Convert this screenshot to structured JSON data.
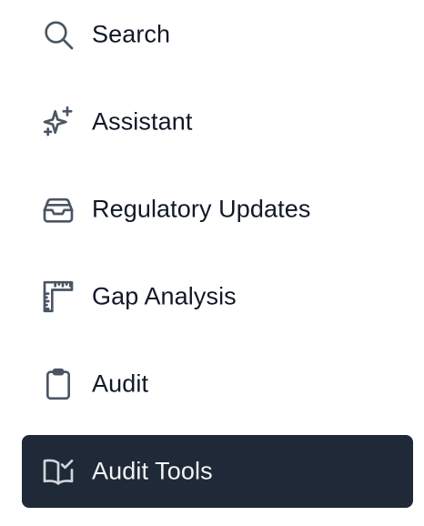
{
  "colors": {
    "background": "#ffffff",
    "text": "#111827",
    "icon": "#4b5563",
    "active_background": "#1f2937",
    "active_text": "#f3f4f6"
  },
  "nav": {
    "items": [
      {
        "label": "Search",
        "icon": "search-icon",
        "active": false
      },
      {
        "label": "Assistant",
        "icon": "sparkles-icon",
        "active": false
      },
      {
        "label": "Regulatory Updates",
        "icon": "inbox-stack-icon",
        "active": false
      },
      {
        "label": "Gap Analysis",
        "icon": "ruler-square-icon",
        "active": false
      },
      {
        "label": "Audit",
        "icon": "clipboard-icon",
        "active": false
      },
      {
        "label": "Audit Tools",
        "icon": "book-check-icon",
        "active": true
      }
    ]
  }
}
